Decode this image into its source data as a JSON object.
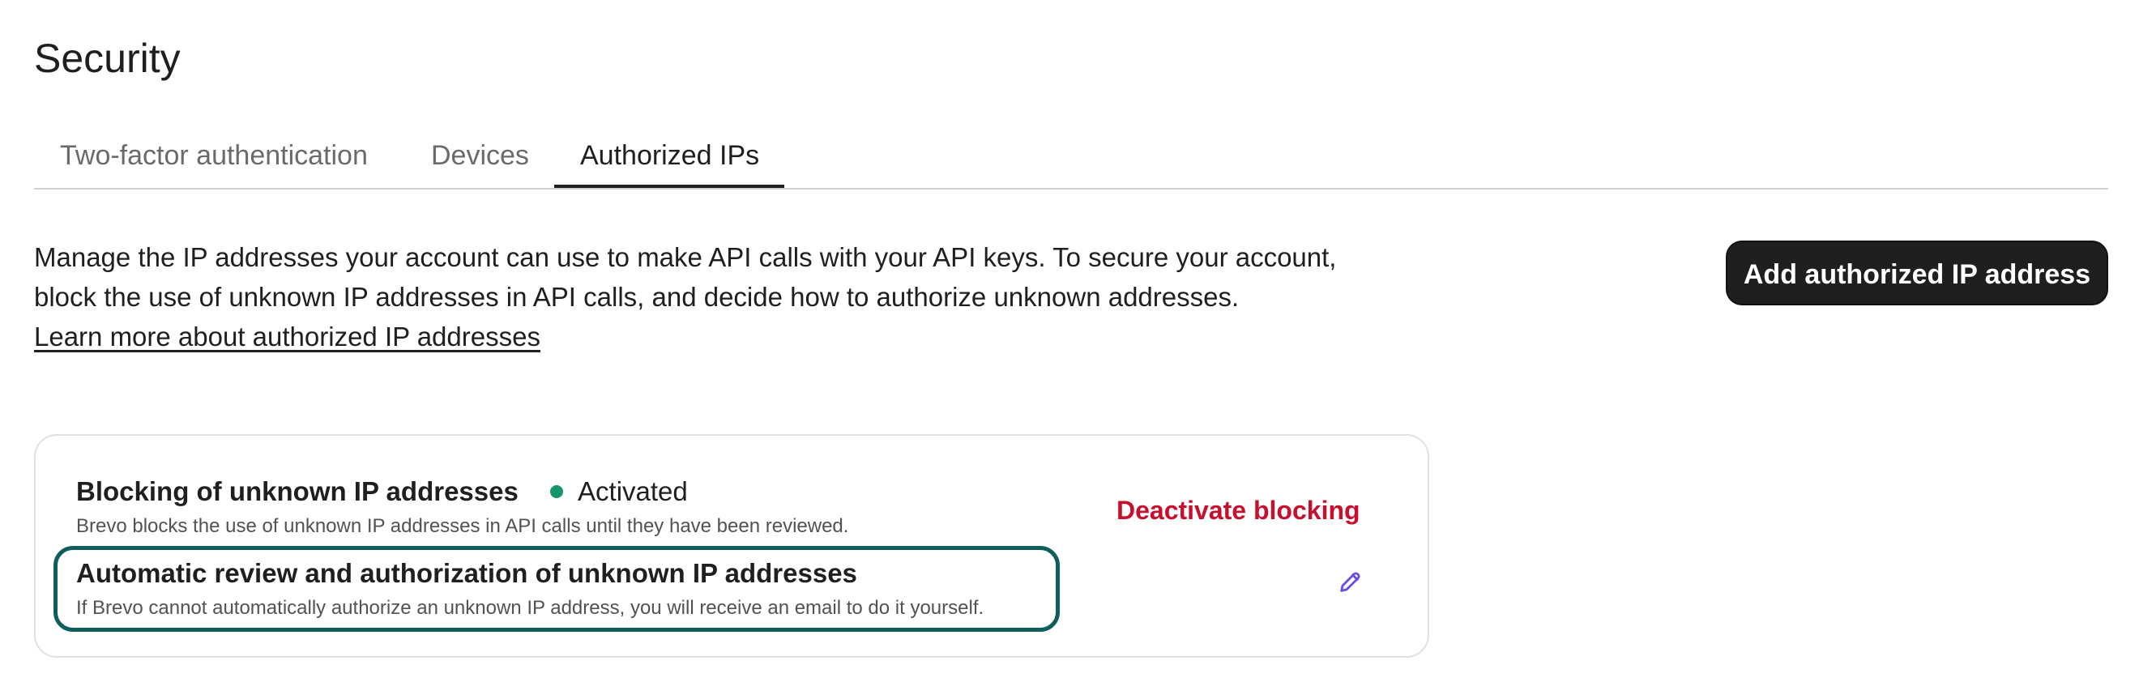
{
  "page": {
    "title": "Security"
  },
  "tabs": [
    {
      "label": "Two-factor authentication",
      "active": false
    },
    {
      "label": "Devices",
      "active": false
    },
    {
      "label": "Authorized IPs",
      "active": true
    }
  ],
  "intro": {
    "line1": "Manage the IP addresses your account can use to make API calls with your API keys. To secure your account,",
    "line2": "block the use of unknown IP addresses in API calls, and decide how to authorize unknown addresses.",
    "learn_more_label": "Learn more about authorized IP addresses"
  },
  "actions": {
    "add_authorized_ip_label": "Add authorized IP address"
  },
  "card": {
    "blocking": {
      "title": "Blocking of unknown IP addresses",
      "status": "Activated",
      "status_color": "#14956a",
      "description": "Brevo blocks the use of unknown IP addresses in API calls until they have been reviewed.",
      "action_label": "Deactivate blocking",
      "action_color": "#c8102e"
    },
    "auto_review": {
      "title": "Automatic review and authorization of unknown IP addresses",
      "description": "If Brevo cannot automatically authorize an unknown IP address, you will receive an email to do it yourself.",
      "edit_icon": "pencil-icon",
      "edit_icon_color": "#6b4ce6"
    }
  }
}
